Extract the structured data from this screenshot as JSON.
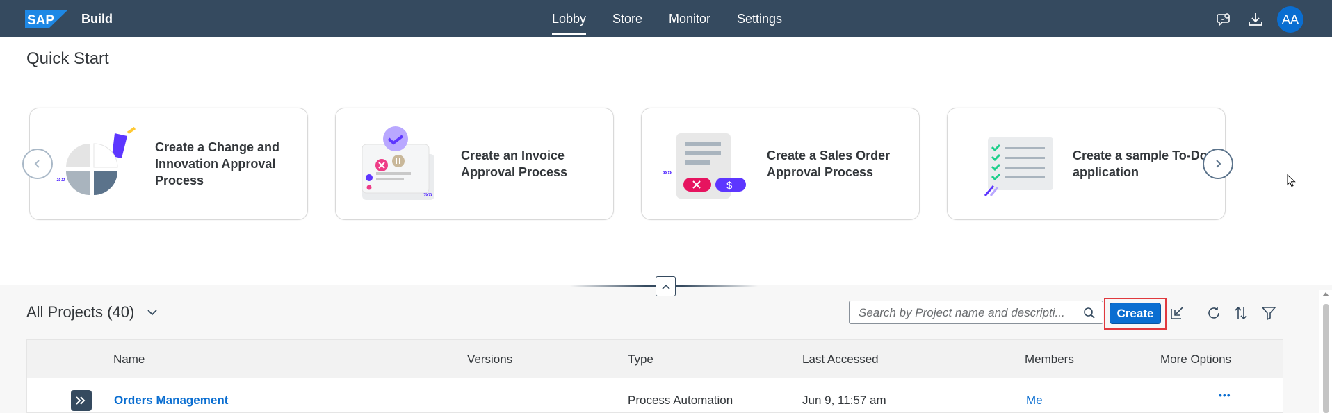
{
  "shell": {
    "logo_text": "SAP",
    "product": "Build",
    "nav": [
      "Lobby",
      "Store",
      "Monitor",
      "Settings"
    ],
    "active_nav": "Lobby",
    "avatar_initials": "AA",
    "icons": [
      "feedback-icon",
      "download-icon"
    ]
  },
  "quick_start": {
    "title": "Quick Start",
    "cards": [
      {
        "label": "Create a Change and Innovation Approval Process",
        "icon": "pie-chart-illustration"
      },
      {
        "label": "Create an Invoice Approval Process",
        "icon": "invoice-illustration"
      },
      {
        "label": "Create a Sales Order Approval Process",
        "icon": "sales-order-illustration"
      },
      {
        "label": "Create a sample To-Do application",
        "icon": "todo-checklist-illustration"
      }
    ]
  },
  "projects": {
    "title": "All Projects (40)",
    "search_placeholder": "Search by Project name and descripti...",
    "create_label": "Create",
    "columns": [
      "Name",
      "Versions",
      "Type",
      "Last Accessed",
      "Members",
      "More Options"
    ],
    "rows": [
      {
        "name": "Orders Management",
        "versions": "",
        "type": "Process Automation",
        "last_accessed": "Jun 9, 11:57 am",
        "members": "Me",
        "more": "•••"
      }
    ]
  },
  "colors": {
    "shell_bg": "#354a5f",
    "accent": "#0a6ed1",
    "highlight": "#e0393e"
  }
}
